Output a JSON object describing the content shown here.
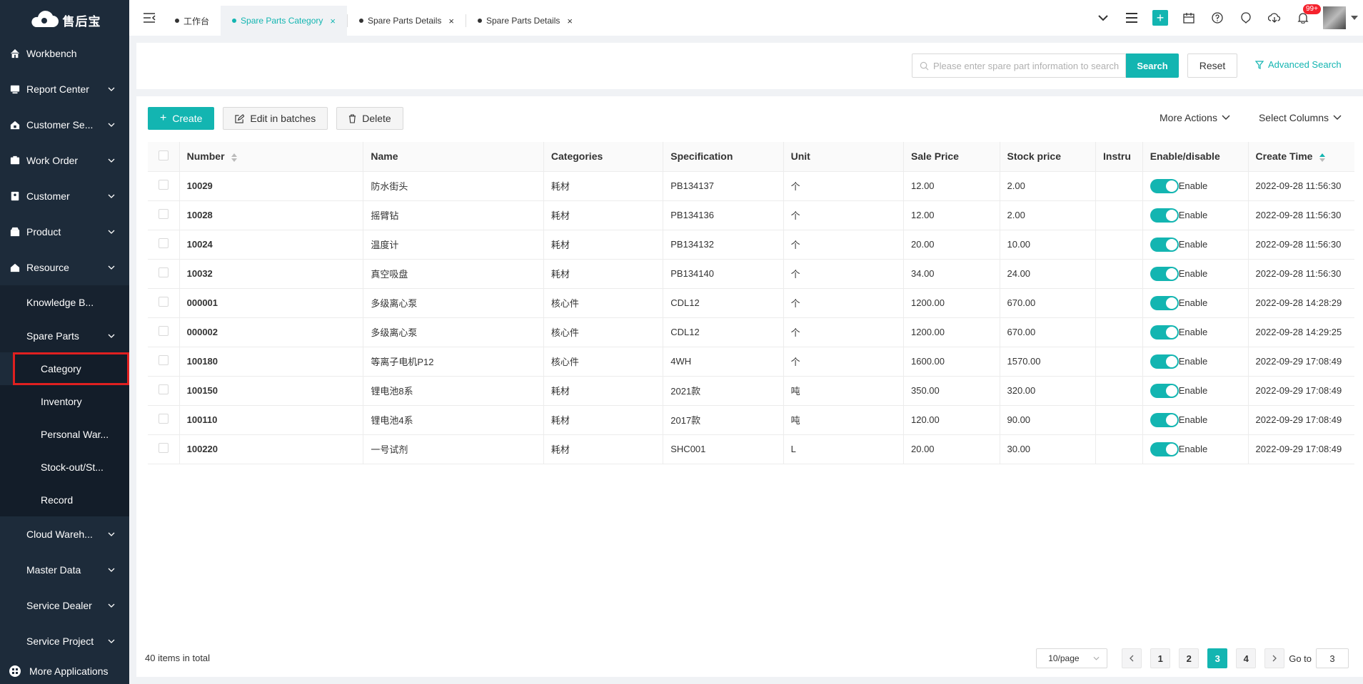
{
  "app": {
    "logo_text": "售后宝"
  },
  "sidebar": {
    "items": [
      {
        "label": "Workbench",
        "icon": "home-icon"
      },
      {
        "label": "Report Center",
        "icon": "report-icon"
      },
      {
        "label": "Customer Se...",
        "icon": "service-icon"
      },
      {
        "label": "Work Order",
        "icon": "work-order-icon"
      },
      {
        "label": "Customer",
        "icon": "customer-icon"
      },
      {
        "label": "Product",
        "icon": "product-icon"
      },
      {
        "label": "Resource",
        "icon": "resource-icon"
      }
    ],
    "resource_sub": {
      "knowledge": "Knowledge B...",
      "spare_parts": "Spare Parts"
    },
    "spare_parts_sub": [
      "Category",
      "Inventory",
      "Personal War...",
      "Stock-out/St...",
      "Record"
    ],
    "more_items": [
      "Cloud Wareh...",
      "Master Data",
      "Service Dealer",
      "Service Project"
    ],
    "more_apps": "More Applications"
  },
  "topbar": {
    "tabs": [
      {
        "label": "工作台",
        "active": false,
        "closable": false
      },
      {
        "label": "Spare Parts Category",
        "active": true,
        "closable": true
      },
      {
        "label": "Spare Parts Details",
        "active": false,
        "closable": true
      },
      {
        "label": "Spare Parts Details",
        "active": false,
        "closable": true
      }
    ],
    "notification_badge": "99+"
  },
  "search": {
    "placeholder": "Please enter spare part information to search",
    "search_label": "Search",
    "reset_label": "Reset",
    "advanced_label": "Advanced Search"
  },
  "toolbar": {
    "create_label": "Create",
    "edit_label": "Edit in batches",
    "delete_label": "Delete",
    "more_actions_label": "More Actions",
    "select_columns_label": "Select Columns"
  },
  "table": {
    "headers": {
      "number": "Number",
      "name": "Name",
      "categories": "Categories",
      "specification": "Specification",
      "unit": "Unit",
      "sale_price": "Sale Price",
      "stock_price": "Stock price",
      "instru": "Instru",
      "enable": "Enable/disable",
      "create_time": "Create Time"
    },
    "rows": [
      {
        "number": "10029",
        "name": "防水街头",
        "category": "耗材",
        "spec": "PB134137",
        "unit": "个",
        "sale": "12.00",
        "stock": "2.00",
        "instru": "",
        "status": "Enable",
        "time": "2022-09-28 11:56:30"
      },
      {
        "number": "10028",
        "name": "摇臂钻",
        "category": "耗材",
        "spec": "PB134136",
        "unit": "个",
        "sale": "12.00",
        "stock": "2.00",
        "instru": "",
        "status": "Enable",
        "time": "2022-09-28 11:56:30"
      },
      {
        "number": "10024",
        "name": "温度计",
        "category": "耗材",
        "spec": "PB134132",
        "unit": "个",
        "sale": "20.00",
        "stock": "10.00",
        "instru": "",
        "status": "Enable",
        "time": "2022-09-28 11:56:30"
      },
      {
        "number": "10032",
        "name": "真空吸盘",
        "category": "耗材",
        "spec": "PB134140",
        "unit": "个",
        "sale": "34.00",
        "stock": "24.00",
        "instru": "",
        "status": "Enable",
        "time": "2022-09-28 11:56:30"
      },
      {
        "number": "000001",
        "name": "多级离心泵",
        "category": "核心件",
        "spec": "CDL12",
        "unit": "个",
        "sale": "1200.00",
        "stock": "670.00",
        "instru": "",
        "status": "Enable",
        "time": "2022-09-28 14:28:29"
      },
      {
        "number": "000002",
        "name": "多级离心泵",
        "category": "核心件",
        "spec": "CDL12",
        "unit": "个",
        "sale": "1200.00",
        "stock": "670.00",
        "instru": "",
        "status": "Enable",
        "time": "2022-09-28 14:29:25"
      },
      {
        "number": "100180",
        "name": "等离子电机P12",
        "category": "核心件",
        "spec": "4WH",
        "unit": "个",
        "sale": "1600.00",
        "stock": "1570.00",
        "instru": "",
        "status": "Enable",
        "time": "2022-09-29 17:08:49"
      },
      {
        "number": "100150",
        "name": "锂电池8系",
        "category": "耗材",
        "spec": "2021款",
        "unit": "吨",
        "sale": "350.00",
        "stock": "320.00",
        "instru": "",
        "status": "Enable",
        "time": "2022-09-29 17:08:49"
      },
      {
        "number": "100110",
        "name": "锂电池4系",
        "category": "耗材",
        "spec": "2017款",
        "unit": "吨",
        "sale": "120.00",
        "stock": "90.00",
        "instru": "",
        "status": "Enable",
        "time": "2022-09-29 17:08:49"
      },
      {
        "number": "100220",
        "name": "一号试剂",
        "category": "耗材",
        "spec": "SHC001",
        "unit": "L",
        "sale": "20.00",
        "stock": "30.00",
        "instru": "",
        "status": "Enable",
        "time": "2022-09-29 17:08:49"
      }
    ]
  },
  "footer": {
    "total_text": "40 items in total",
    "page_size": "10/page",
    "pages": [
      "1",
      "2",
      "3",
      "4"
    ],
    "current_page": "3",
    "goto_label": "Go to",
    "goto_value": "3"
  },
  "colors": {
    "accent": "#13b5b1",
    "sidebar_bg": "#1d2b3a",
    "highlight_border": "#e02020"
  }
}
